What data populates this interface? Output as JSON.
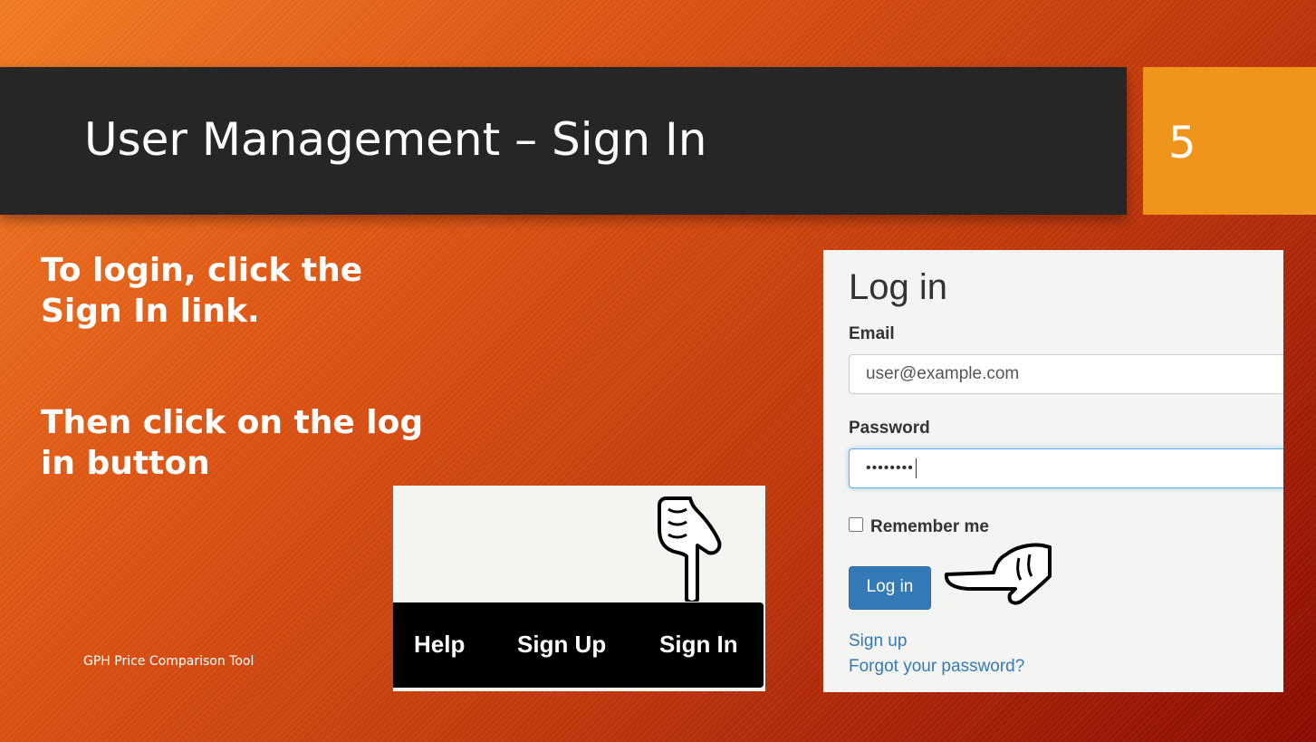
{
  "slide": {
    "title": "User Management – Sign In",
    "number": "5",
    "instructions": [
      "To login, click the\nSign In link.",
      "Then click on the log\nin button"
    ],
    "footer": "GPH Price Comparison Tool"
  },
  "nav_screenshot": {
    "items": [
      "Help",
      "Sign Up",
      "Sign In"
    ],
    "pointer": "hand-pointing-down-icon"
  },
  "login_screenshot": {
    "heading": "Log in",
    "email_label": "Email",
    "email_value": "user@example.com",
    "password_label": "Password",
    "password_value": "••••••••",
    "remember_label": "Remember me",
    "login_button": "Log in",
    "signup_link": "Sign up",
    "forgot_link": "Forgot your password?",
    "pointer": "hand-pointing-left-icon"
  },
  "colors": {
    "title_bar": "#262626",
    "slide_number_box": "#f0951c",
    "background_start": "#ef7a24",
    "background_end": "#8a0b02",
    "button": "#337ab7"
  }
}
